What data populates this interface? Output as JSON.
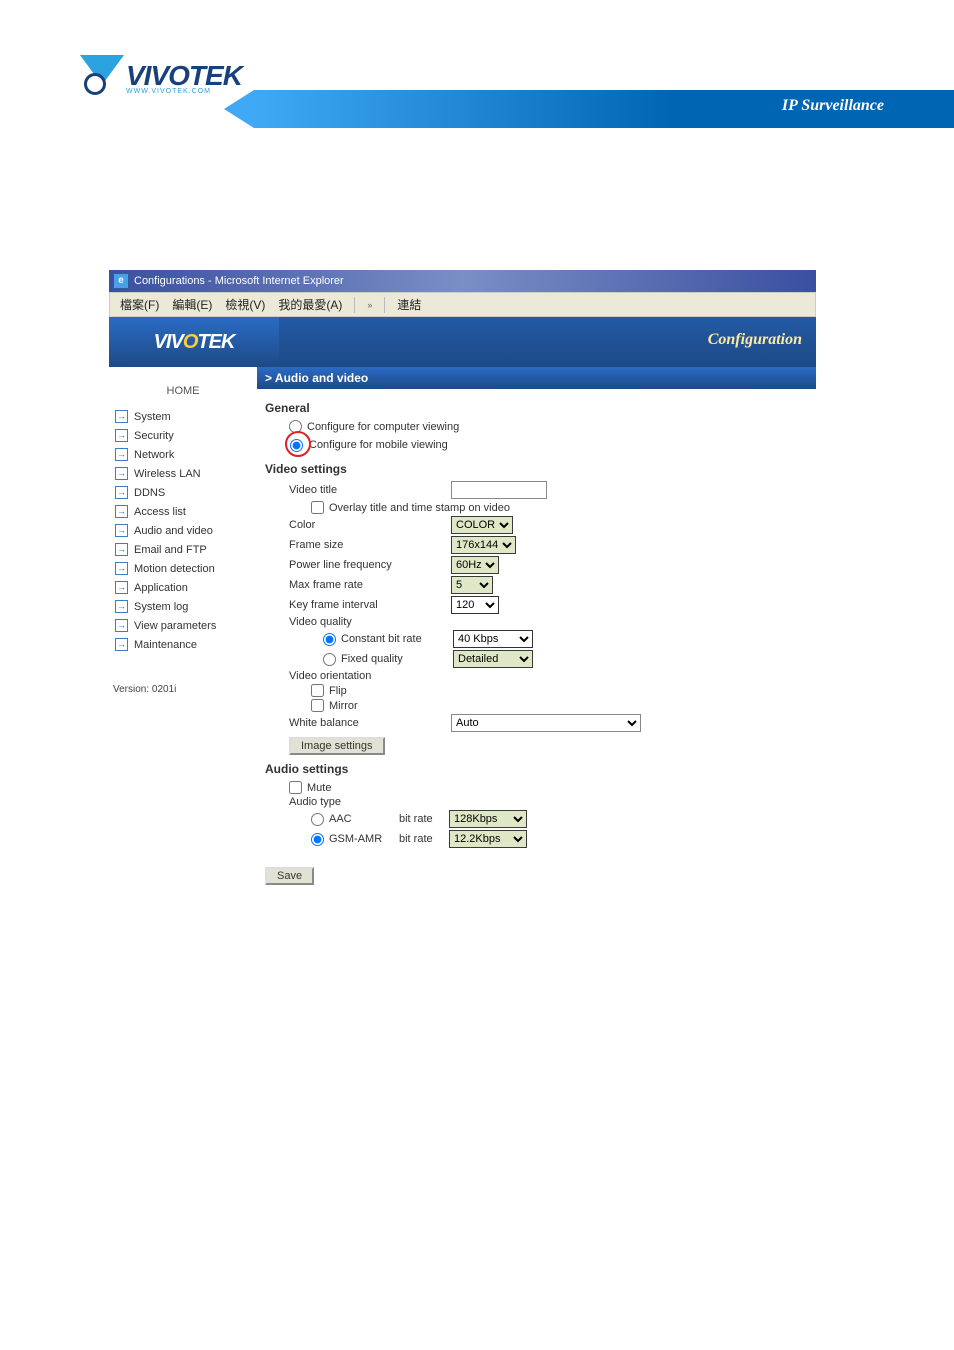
{
  "doc": {
    "ip_text": "IP Surveillance",
    "logo_text": "VIVOTEK",
    "logo_sub": "WWW.VIVOTEK.COM"
  },
  "browser": {
    "title": "Configurations - Microsoft Internet Explorer",
    "menus": {
      "file": "檔案(F)",
      "edit": "編輯(E)",
      "view": "檢視(V)",
      "fav": "我的最愛(A)",
      "more": "»",
      "links": "連結"
    }
  },
  "app": {
    "config_label": "Configuration",
    "logo_text": "VIVOTEK"
  },
  "sidebar": {
    "home": "HOME",
    "items": [
      {
        "label": "System"
      },
      {
        "label": "Security"
      },
      {
        "label": "Network"
      },
      {
        "label": "Wireless LAN"
      },
      {
        "label": "DDNS"
      },
      {
        "label": "Access list"
      },
      {
        "label": "Audio and video"
      },
      {
        "label": "Email and FTP"
      },
      {
        "label": "Motion detection"
      },
      {
        "label": "Application"
      },
      {
        "label": "System log"
      },
      {
        "label": "View parameters"
      },
      {
        "label": "Maintenance"
      }
    ],
    "version": "Version: 0201i"
  },
  "content": {
    "breadcrumb": "> Audio and video",
    "general": {
      "heading": "General",
      "opt_computer": "Configure for computer viewing",
      "opt_mobile": "Configure for mobile viewing"
    },
    "video": {
      "heading": "Video settings",
      "title_label": "Video title",
      "title_value": "",
      "overlay": "Overlay title and time stamp on video",
      "color_label": "Color",
      "color_value": "COLOR",
      "frame_size_label": "Frame size",
      "frame_size_value": "176x144",
      "plf_label": "Power line frequency",
      "plf_value": "60Hz",
      "max_fr_label": "Max frame rate",
      "max_fr_value": "5",
      "kfi_label": "Key frame interval",
      "kfi_value": "120",
      "vq_label": "Video quality",
      "cbr_label": "Constant bit rate",
      "cbr_value": "40 Kbps",
      "fq_label": "Fixed quality",
      "fq_value": "Detailed",
      "orient_label": "Video orientation",
      "flip": "Flip",
      "mirror": "Mirror",
      "wb_label": "White balance",
      "wb_value": "Auto",
      "img_settings_btn": "Image settings"
    },
    "audio": {
      "heading": "Audio settings",
      "mute": "Mute",
      "type_label": "Audio type",
      "aac_label": "AAC",
      "bitrate_label": "bit rate",
      "aac_value": "128Kbps",
      "gsm_label": "GSM-AMR",
      "gsm_value": "12.2Kbps"
    },
    "save_btn": "Save"
  }
}
